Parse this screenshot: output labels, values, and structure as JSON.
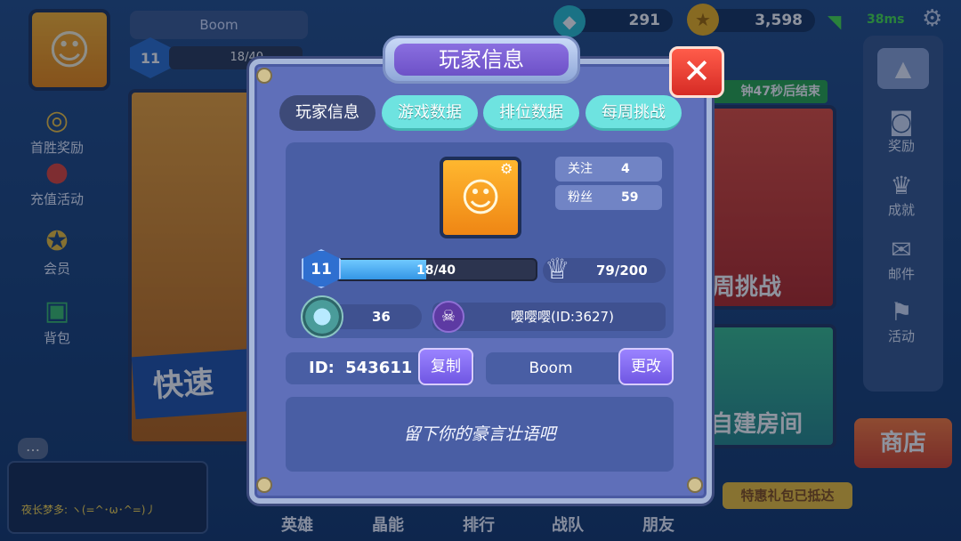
{
  "topbar": {
    "player_name": "Boom",
    "level": "11",
    "exp_text": "18/40",
    "gems": "291",
    "coins": "3,598",
    "ping": "38ms"
  },
  "left_menu": [
    {
      "label": "首胜奖励",
      "icon": "coin-stack-icon"
    },
    {
      "label": "充值活动",
      "icon": "money-bag-icon"
    },
    {
      "label": "会员",
      "icon": "vip-medal-icon"
    },
    {
      "label": "背包",
      "icon": "backpack-icon"
    }
  ],
  "bg_cards": {
    "quick_match": "快速",
    "weekly_timer": "钟47秒后结束",
    "weekly_label": "周挑战",
    "custom_room": "自建房间"
  },
  "right_menu": [
    {
      "label": "奖励",
      "icon": "reward-bag-icon"
    },
    {
      "label": "成就",
      "icon": "trophy-icon"
    },
    {
      "label": "邮件",
      "icon": "mail-icon"
    },
    {
      "label": "活动",
      "icon": "flag-icon"
    }
  ],
  "shop_label": "商店",
  "gift_banner": "特惠礼包已抵达",
  "chat": {
    "message": "夜长梦多: ヽ(=^･ω･^=)丿"
  },
  "bottom_tabs": [
    "英雄",
    "晶能",
    "排行",
    "战队",
    "朋友"
  ],
  "modal": {
    "title": "玩家信息",
    "close_icon": "close-x-icon",
    "tabs": [
      {
        "label": "玩家信息",
        "active": true
      },
      {
        "label": "游戏数据",
        "active": false
      },
      {
        "label": "排位数据",
        "active": false
      },
      {
        "label": "每周挑战",
        "active": false
      }
    ],
    "follow_label": "关注",
    "follow_value": "4",
    "fans_label": "粉丝",
    "fans_value": "59",
    "level": "11",
    "exp_text": "18/40",
    "exp_progress": 0.45,
    "trophies": "79/200",
    "rank_value": "36",
    "clan_name": "嘤嘤嘤(ID:3627)",
    "id_label": "ID:",
    "id_value": "543611",
    "copy_label": "复制",
    "name": "Boom",
    "change_label": "更改",
    "motto_placeholder": "留下你的豪言壮语吧"
  },
  "colors": {
    "modal_bg": "#5f6fb9",
    "tab_inactive": "#6ee3e0",
    "tab_active": "#3d4a78",
    "close_red": "#e03a30",
    "button_purple": "#7e66ee"
  }
}
